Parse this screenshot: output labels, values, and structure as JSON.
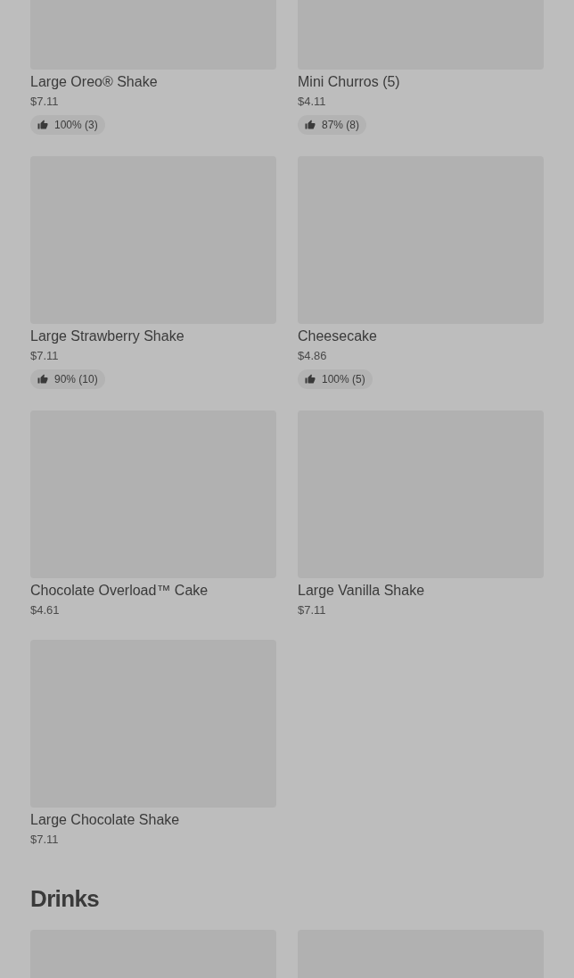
{
  "items": [
    {
      "name": "Large Oreo® Shake",
      "price": "$7.11",
      "rating": "100% (3)"
    },
    {
      "name": "Mini Churros (5)",
      "price": "$4.11",
      "rating": "87% (8)"
    },
    {
      "name": "Large Strawberry Shake",
      "price": "$7.11",
      "rating": "90% (10)"
    },
    {
      "name": "Cheesecake",
      "price": "$4.86",
      "rating": "100% (5)"
    },
    {
      "name": "Chocolate Overload™ Cake",
      "price": "$4.61"
    },
    {
      "name": "Large Vanilla Shake",
      "price": "$7.11"
    },
    {
      "name": "Large Chocolate Shake",
      "price": "$7.11"
    }
  ],
  "drinks": {
    "heading": "Drinks",
    "items": [
      {
        "kind": "image"
      },
      {
        "kind": "image"
      }
    ]
  }
}
